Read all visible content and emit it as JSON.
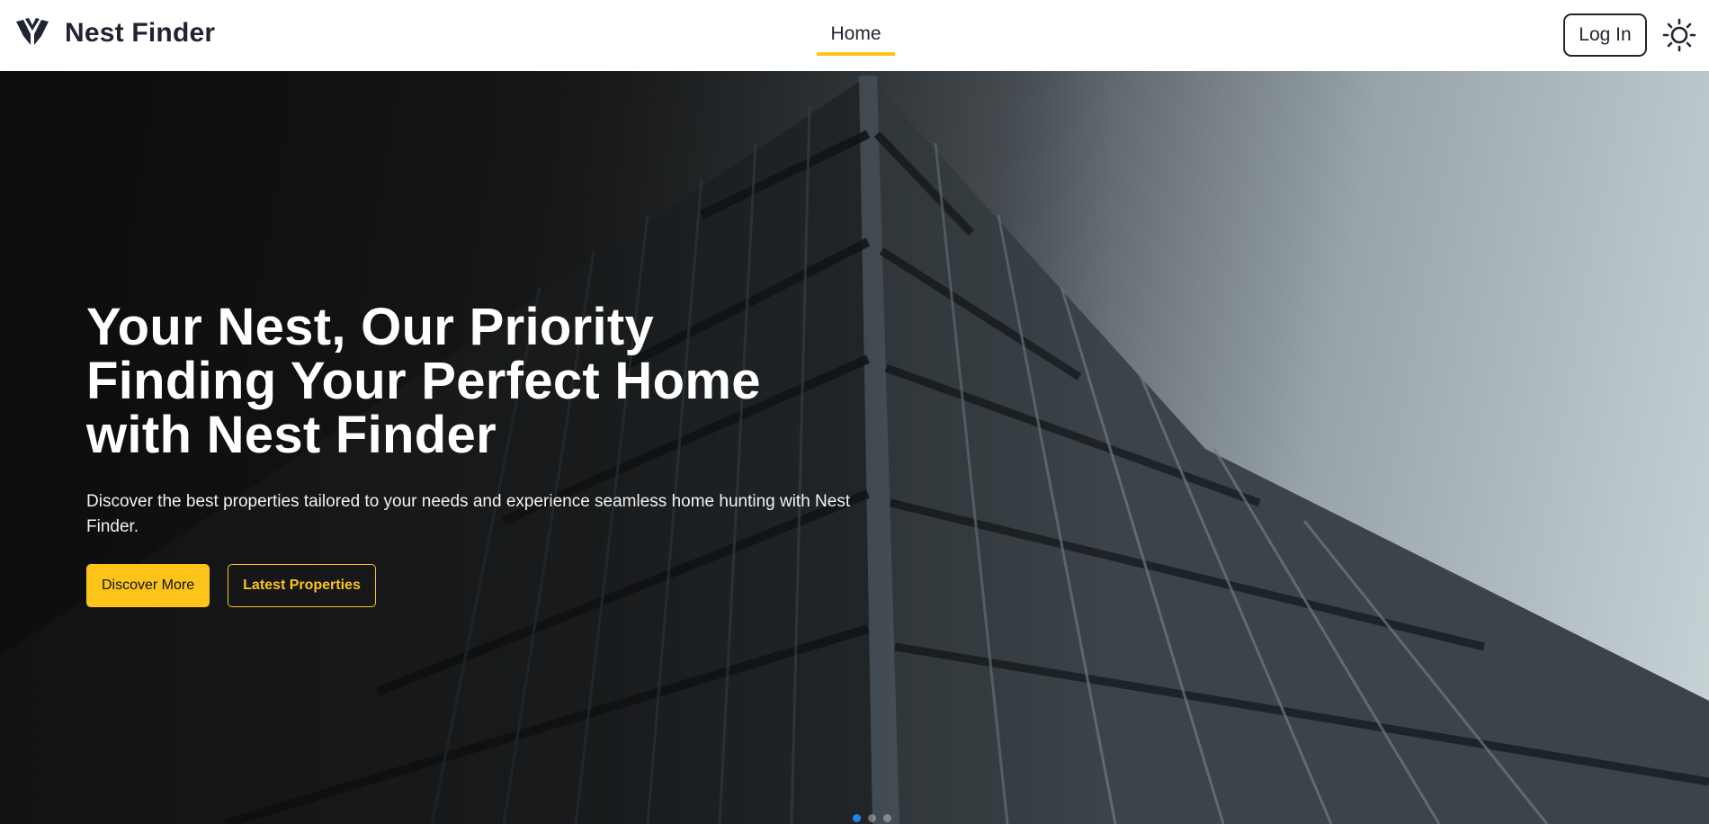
{
  "app": {
    "name": "Nest Finder",
    "logo_icon": "nest-finder-logo-icon"
  },
  "nav": {
    "items": [
      {
        "label": "Home",
        "active": true
      }
    ],
    "login_label": "Log In",
    "theme_icon": "sun-icon"
  },
  "hero": {
    "title_lines": [
      "Your Nest, Our Priority",
      "Finding Your Perfect Home",
      "with Nest Finder"
    ],
    "subtitle": "Discover the best properties tailored to your needs and experience seamless home hunting with Nest Finder.",
    "primary_button": "Discover More",
    "secondary_button": "Latest Properties",
    "background_image": "modern apartment building facade, low-angle view",
    "carousel": {
      "slides": 3,
      "active_index": 0
    }
  },
  "colors": {
    "accent": "#fcc419",
    "text_dark": "#1f2430",
    "active_dot": "#1e88e5"
  }
}
